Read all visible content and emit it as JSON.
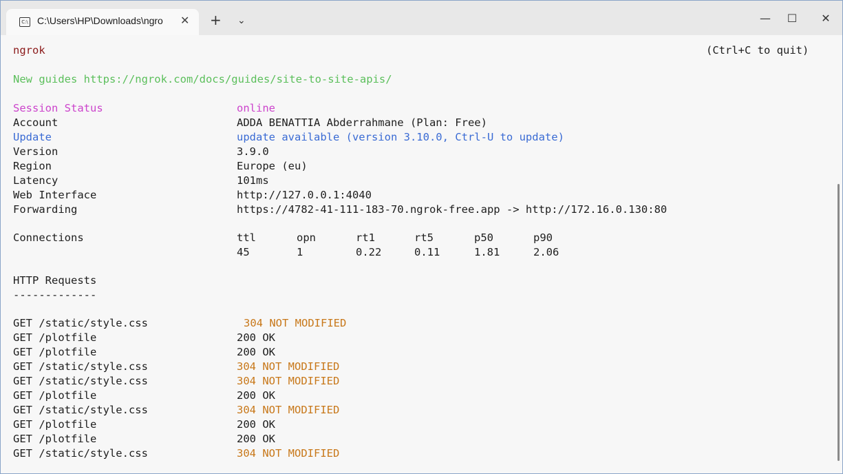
{
  "window": {
    "tab_title": "C:\\Users\\HP\\Downloads\\ngro",
    "tab_icon": "terminal-icon",
    "new_tab": "+",
    "dropdown": "⌄",
    "minimize": "—",
    "maximize": "☐",
    "close": "✕"
  },
  "terminal": {
    "app_name": "ngrok",
    "quit_hint": "(Ctrl+C to quit)",
    "guides_line": "New guides https://ngrok.com/docs/guides/site-to-site-apis/",
    "status": {
      "session_status_label": "Session Status",
      "session_status_value": "online",
      "account_label": "Account",
      "account_value": "ADDA BENATTIA Abderrahmane (Plan: Free)",
      "update_label": "Update",
      "update_value": "update available (version 3.10.0, Ctrl-U to update)",
      "version_label": "Version",
      "version_value": "3.9.0",
      "region_label": "Region",
      "region_value": "Europe (eu)",
      "latency_label": "Latency",
      "latency_value": "101ms",
      "web_interface_label": "Web Interface",
      "web_interface_value": "http://127.0.0.1:4040",
      "forwarding_label": "Forwarding",
      "forwarding_value": "https://4782-41-111-183-70.ngrok-free.app -> http://172.16.0.130:80"
    },
    "connections": {
      "label": "Connections",
      "headers": [
        "ttl",
        "opn",
        "rt1",
        "rt5",
        "p50",
        "p90"
      ],
      "values": [
        "45",
        "1",
        "0.22",
        "0.11",
        "1.81",
        "2.06"
      ]
    },
    "http_requests": {
      "title": "HTTP Requests",
      "divider": "-------------",
      "rows": [
        {
          "request": "GET /static/style.css",
          "status": "304 NOT MODIFIED"
        },
        {
          "request": "GET /plotfile",
          "status": "200 OK"
        },
        {
          "request": "GET /plotfile",
          "status": "200 OK"
        },
        {
          "request": "GET /static/style.css",
          "status": "304 NOT MODIFIED"
        },
        {
          "request": "GET /static/style.css",
          "status": "304 NOT MODIFIED"
        },
        {
          "request": "GET /plotfile",
          "status": "200 OK"
        },
        {
          "request": "GET /static/style.css",
          "status": "304 NOT MODIFIED"
        },
        {
          "request": "GET /plotfile",
          "status": "200 OK"
        },
        {
          "request": "GET /plotfile",
          "status": "200 OK"
        },
        {
          "request": "GET /static/style.css",
          "status": "304 NOT MODIFIED"
        }
      ]
    }
  },
  "colors": {
    "app_name": "#8b1a1a",
    "guides": "#5bbf5b",
    "session_status": "#cc44cc",
    "update": "#3a6bd4",
    "not_modified": "#c8781a"
  }
}
